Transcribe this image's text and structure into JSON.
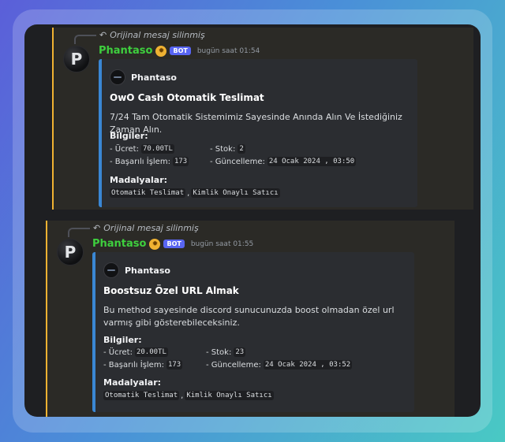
{
  "messages": [
    {
      "reply_text": "Orijinal mesaj silinmiş",
      "avatar_letter": "P",
      "username": "Phantaso",
      "bot_tag": "BOT",
      "timestamp": "bugün saat 01:54",
      "embed": {
        "author": "Phantaso",
        "title": "OwO Cash Otomatik Teslimat",
        "description": "7/24 Tam Otomatik Sistemimiz Sayesinde Anında Alın Ve İstediğiniz Zaman Alın.",
        "info_label": "Bilgiler:",
        "price_label": "- Ücret:",
        "price_value": "70.00TL",
        "stock_label": "- Stok:",
        "stock_value": "2",
        "success_label": "- Başarılı İşlem:",
        "success_value": "173",
        "update_label": "- Güncelleme:",
        "update_value": "24 Ocak 2024 , 03:50",
        "medals_label": "Madalyalar:",
        "medal_1": "Otomatik Teslimat",
        "medal_sep": ",",
        "medal_2": "Kimlik Onaylı Satıcı"
      }
    },
    {
      "reply_text": "Orijinal mesaj silinmiş",
      "avatar_letter": "P",
      "username": "Phantaso",
      "bot_tag": "BOT",
      "timestamp": "bugün saat 01:55",
      "embed": {
        "author": "Phantaso",
        "title": "Boostsuz Özel URL Almak",
        "description": "Bu method sayesinde discord sunucunuzda boost olmadan özel url varmış gibi gösterebileceksiniz.",
        "info_label": "Bilgiler:",
        "price_label": "- Ücret:",
        "price_value": "20.00TL",
        "stock_label": "- Stok:",
        "stock_value": "23",
        "success_label": "- Başarılı İşlem:",
        "success_value": "173",
        "update_label": "- Güncelleme:",
        "update_value": "24 Ocak 2024 , 03:52",
        "medals_label": "Madalyalar:",
        "medal_1": "Otomatik Teslimat",
        "medal_sep": ",",
        "medal_2": "Kimlik Onaylı Satıcı"
      }
    }
  ],
  "colors": {
    "username": "#3ecf3e",
    "embed_accent": "#3a87d4",
    "highlight_bar": "#f0b232",
    "bot_tag": "#5865f2"
  },
  "icons": {
    "reply": "reply-arrow-icon",
    "badge": "sun-badge-icon",
    "author": "author-avatar-icon"
  }
}
